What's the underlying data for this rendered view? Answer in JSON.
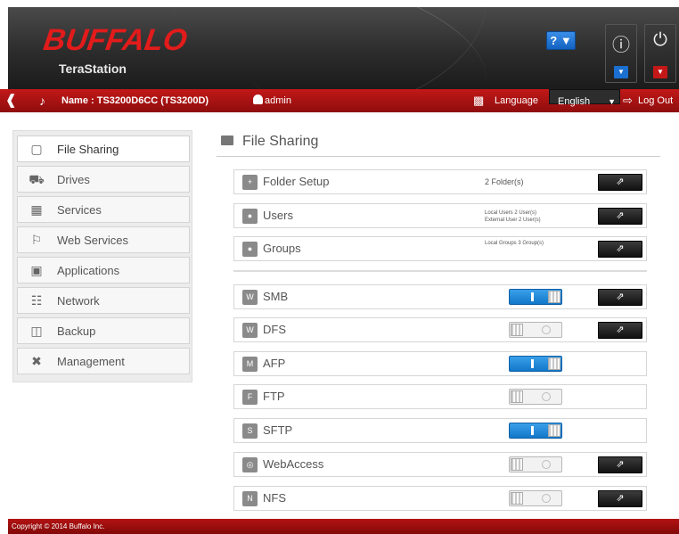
{
  "header": {
    "brand": "BUFFALO",
    "product": "TeraStation",
    "help_label": "? ▼",
    "info_icon": "info-icon",
    "power_icon": "power-icon",
    "accent_blue": "#1a6fd0",
    "accent_red": "#c41818"
  },
  "topbar": {
    "device_name": "Name : TS3200D6CC (TS3200D)",
    "user": "admin",
    "language_label": "Language",
    "language_value": "English",
    "logout_label": "Log Out"
  },
  "sidebar": {
    "items": [
      {
        "label": "File Sharing",
        "icon": "folder-icon",
        "active": true
      },
      {
        "label": "Drives",
        "icon": "drive-icon"
      },
      {
        "label": "Services",
        "icon": "services-icon"
      },
      {
        "label": "Web Services",
        "icon": "web-services-icon"
      },
      {
        "label": "Applications",
        "icon": "applications-icon"
      },
      {
        "label": "Network",
        "icon": "network-icon"
      },
      {
        "label": "Backup",
        "icon": "backup-icon"
      },
      {
        "label": "Management",
        "icon": "management-icon"
      }
    ]
  },
  "main": {
    "title": "File Sharing",
    "setup_rows": [
      {
        "label": "Folder Setup",
        "info": "2 Folder(s)"
      },
      {
        "label": "Users",
        "info_line1": "Local Users 2 User(s)",
        "info_line2": "External User 2 User(s)"
      },
      {
        "label": "Groups",
        "info": "Local Groups 3 Group(s)"
      }
    ],
    "services": [
      {
        "label": "SMB",
        "enabled": true,
        "has_open": true
      },
      {
        "label": "DFS",
        "enabled": false,
        "has_open": true
      },
      {
        "label": "AFP",
        "enabled": true,
        "has_open": false
      },
      {
        "label": "FTP",
        "enabled": false,
        "has_open": false
      },
      {
        "label": "SFTP",
        "enabled": true,
        "has_open": false
      },
      {
        "label": "WebAccess",
        "enabled": false,
        "has_open": true
      },
      {
        "label": "NFS",
        "enabled": false,
        "has_open": true
      }
    ]
  },
  "footer": {
    "copyright": "Copyright © 2014 Buffalo Inc."
  }
}
